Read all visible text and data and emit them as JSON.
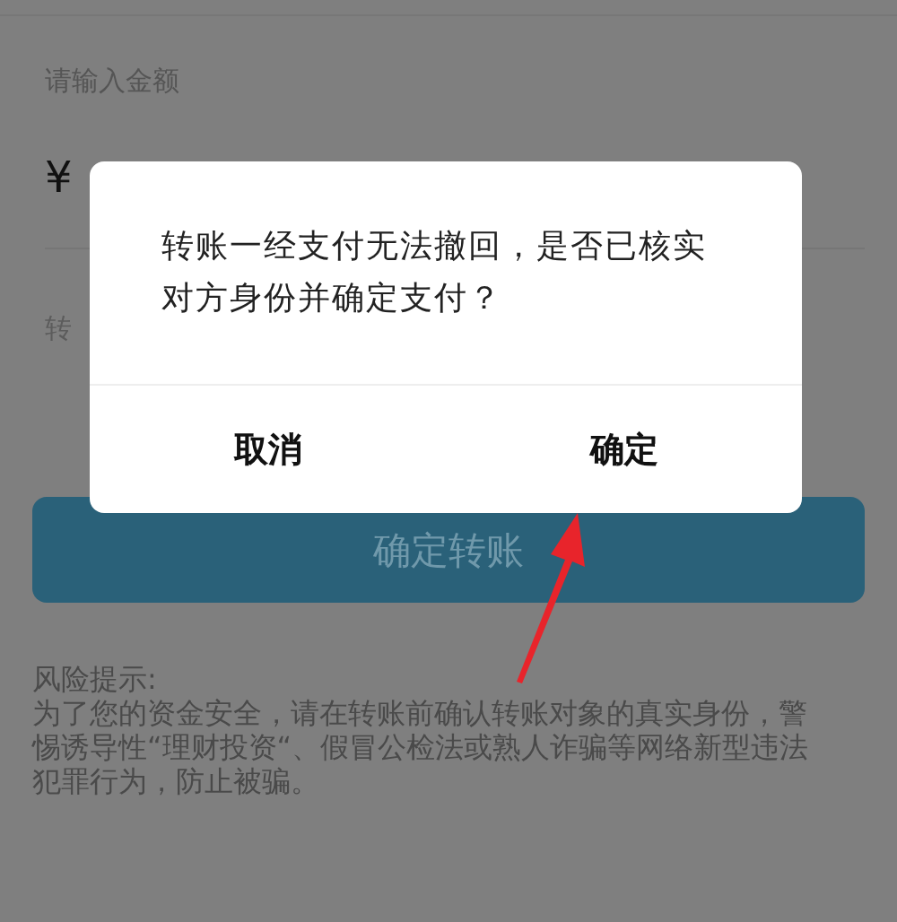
{
  "form": {
    "amount_label": "请输入金额",
    "currency": "¥",
    "note_label": "转"
  },
  "submit_button": {
    "label": "确定转账"
  },
  "risk_notice": {
    "title": "风险提示:",
    "body": "为了您的资金安全，请在转账前确认转账对象的真实身份，警惕诱导性“理财投资“、假冒公检法或熟人诈骗等网络新型违法犯罪行为，防止被骗。"
  },
  "dialog": {
    "message": "转账一经支付无法撤回，是否已核实对方身份并确定支付？",
    "buttons": [
      {
        "label": "取消"
      },
      {
        "label": "确定"
      }
    ]
  }
}
